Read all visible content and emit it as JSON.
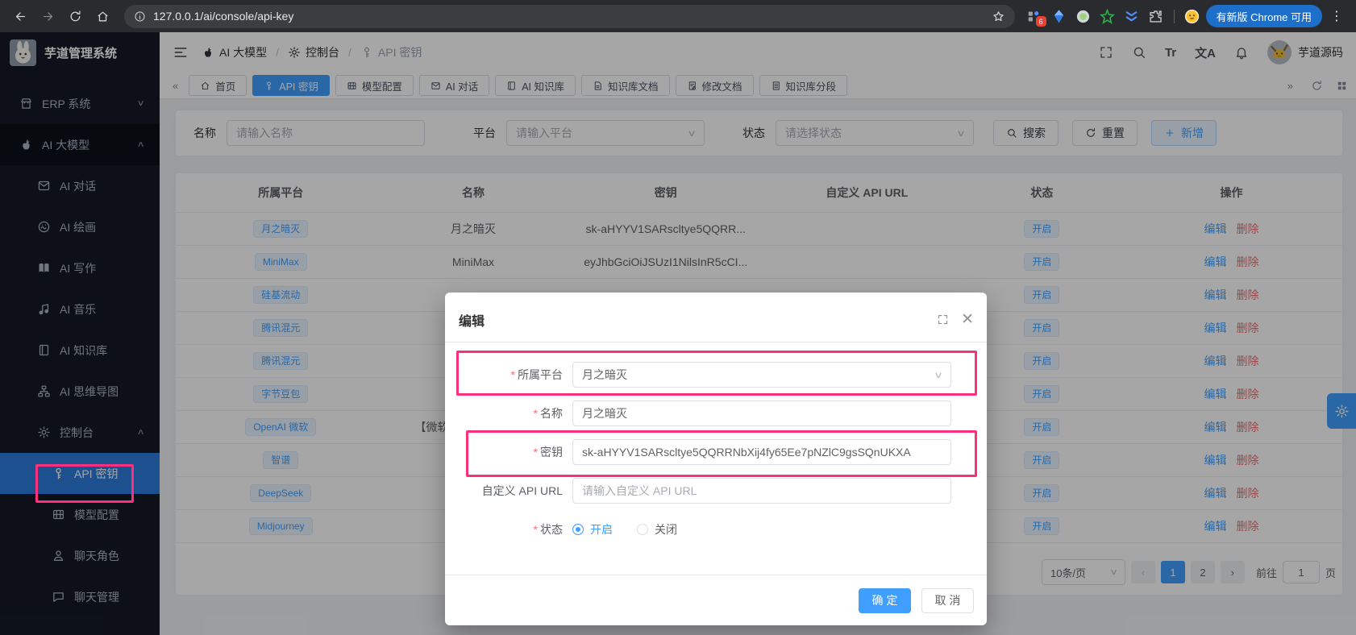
{
  "browser": {
    "url": "127.0.0.1/ai/console/api-key",
    "ext_badge": "6",
    "update_button": "有新版 Chrome 可用"
  },
  "logo_title": "芋道管理系统",
  "header": {
    "breadcrumb": [
      {
        "icon": "apple",
        "label": "AI 大模型"
      },
      {
        "icon": "gear",
        "label": "控制台"
      },
      {
        "icon": "key",
        "label": "API 密钥"
      }
    ],
    "font_icon_text": "Tr",
    "translate_icon_text": "文A",
    "username": "芋道源码"
  },
  "sidebar": {
    "items": [
      {
        "icon": "store",
        "label": "ERP 系统",
        "level": "top",
        "chevron": "down"
      },
      {
        "icon": "apple",
        "label": "AI 大模型",
        "level": "top",
        "chevron": "up",
        "expanded": true
      },
      {
        "icon": "mail",
        "label": "AI 对话",
        "level": "sub"
      },
      {
        "icon": "paint",
        "label": "AI 绘画",
        "level": "sub"
      },
      {
        "icon": "write",
        "label": "AI 写作",
        "level": "sub"
      },
      {
        "icon": "music",
        "label": "AI 音乐",
        "level": "sub"
      },
      {
        "icon": "notebook",
        "label": "AI 知识库",
        "level": "sub"
      },
      {
        "icon": "mindmap",
        "label": "AI 思维导图",
        "level": "sub"
      },
      {
        "icon": "gear",
        "label": "控制台",
        "level": "sub",
        "chevron": "up"
      },
      {
        "icon": "key",
        "label": "API 密钥",
        "level": "subsub",
        "active": true
      },
      {
        "icon": "config",
        "label": "模型配置",
        "level": "subsub"
      },
      {
        "icon": "person",
        "label": "聊天角色",
        "level": "subsub"
      },
      {
        "icon": "bubble",
        "label": "聊天管理",
        "level": "subsub"
      }
    ]
  },
  "tabs": {
    "items": [
      {
        "icon": "home",
        "label": "首页"
      },
      {
        "icon": "key",
        "label": "API 密钥",
        "active": true
      },
      {
        "icon": "config",
        "label": "模型配置"
      },
      {
        "icon": "mail",
        "label": "AI 对话"
      },
      {
        "icon": "notebook",
        "label": "AI 知识库"
      },
      {
        "icon": "doc",
        "label": "知识库文档"
      },
      {
        "icon": "docedit",
        "label": "修改文档"
      },
      {
        "icon": "docseg",
        "label": "知识库分段"
      }
    ]
  },
  "filters": {
    "name_label": "名称",
    "name_placeholder": "请输入名称",
    "platform_label": "平台",
    "platform_placeholder": "请输入平台",
    "status_label": "状态",
    "status_placeholder": "请选择状态",
    "search": "搜索",
    "reset": "重置",
    "create": "新增"
  },
  "table": {
    "headers": [
      "所属平台",
      "名称",
      "密钥",
      "自定义 API URL",
      "状态",
      "操作"
    ],
    "edit": "编辑",
    "delete": "删除",
    "rows": [
      {
        "platform": "月之暗灭",
        "name": "月之暗灭",
        "key": "sk-aHYYV1SARscltye5QQRR...",
        "url": "",
        "status": "开启"
      },
      {
        "platform": "MiniMax",
        "name": "MiniMax",
        "key": "eyJhbGciOiJSUzI1NilsInR5cCI...",
        "url": "",
        "status": "开启"
      },
      {
        "platform": "硅基流动",
        "name": "",
        "key": "",
        "url": "",
        "status": "开启"
      },
      {
        "platform": "腾讯混元",
        "name": "",
        "key": "",
        "url": "",
        "status": "开启"
      },
      {
        "platform": "腾讯混元",
        "name": "",
        "key": "",
        "url": "",
        "status": "开启"
      },
      {
        "platform": "字节豆包",
        "name": "",
        "key": "",
        "url": "",
        "status": "开启"
      },
      {
        "platform": "OpenAI 微软",
        "name": "【微软",
        "name_shift": true,
        "key": "",
        "url": "",
        "status": "开启"
      },
      {
        "platform": "智谱",
        "name": "",
        "key": "",
        "url": "",
        "status": "开启"
      },
      {
        "platform": "DeepSeek",
        "name": "",
        "key": "",
        "url": "",
        "status": "开启"
      },
      {
        "platform": "Midjourney",
        "name": "",
        "key": "",
        "url": "",
        "status": "开启"
      }
    ]
  },
  "pagination": {
    "size": "10条/页",
    "pages": [
      "1",
      "2"
    ],
    "active": "1",
    "goto": "前往",
    "page_value": "1",
    "unit": "页"
  },
  "modal": {
    "title": "编辑",
    "fields": {
      "platform_label": "所属平台",
      "platform_value": "月之暗灭",
      "name_label": "名称",
      "name_value": "月之暗灭",
      "key_label": "密钥",
      "key_value": "sk-aHYYV1SARscltye5QQRRNbXij4fy65Ee7pNZlC9gsSQnUKXA",
      "url_label": "自定义 API URL",
      "url_placeholder": "请输入自定义 API URL",
      "status_label": "状态",
      "status_on": "开启",
      "status_off": "关闭"
    },
    "confirm": "确 定",
    "cancel": "取 消"
  },
  "colors": {
    "primary": "#409eff",
    "danger": "#f56c6c",
    "annotation": "#fb2f7b"
  }
}
